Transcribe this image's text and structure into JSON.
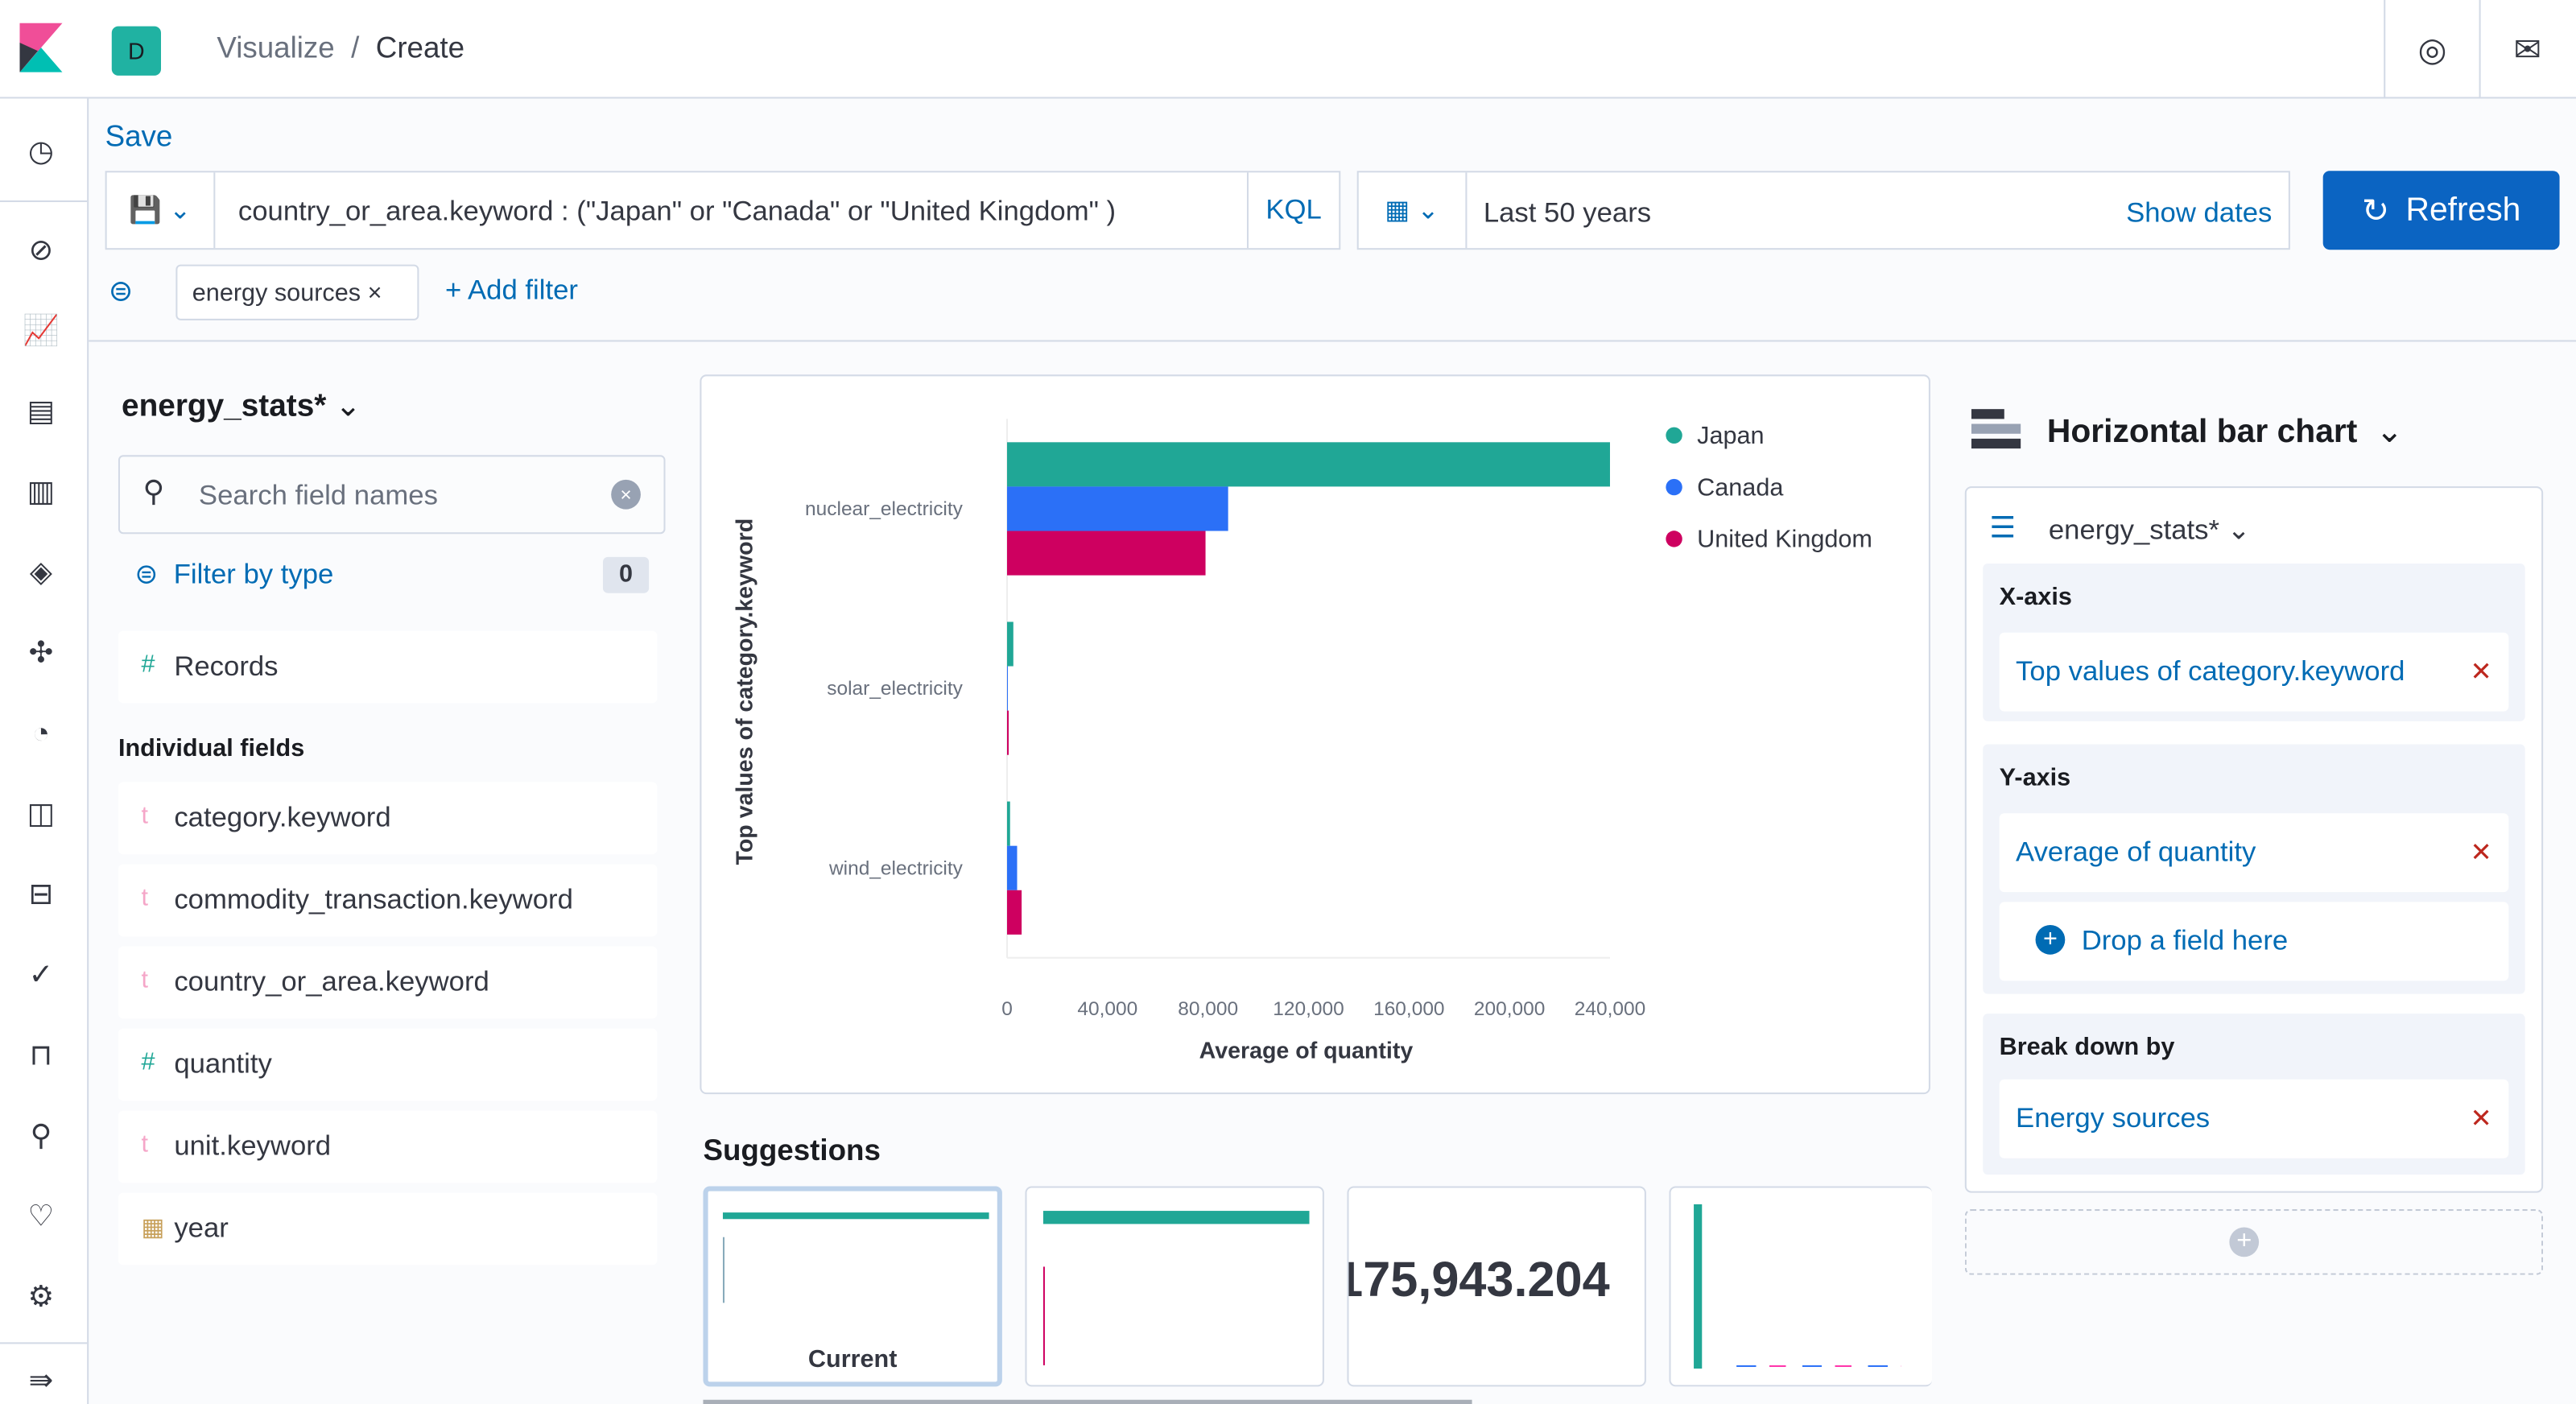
{
  "header": {
    "avatar": "D",
    "breadcrumbs": [
      "Visualize",
      "Create"
    ],
    "icons": [
      "help-icon",
      "mail-icon"
    ]
  },
  "toolbar": {
    "save": "Save",
    "query": "country_or_area.keyword : (\"Japan\" or \"Canada\"  or \"United Kingdom\" )",
    "kql": "KQL",
    "time": "Last 50 years",
    "show_dates": "Show dates",
    "refresh": "Refresh"
  },
  "filters": {
    "pill": "energy sources",
    "add": "+ Add filter"
  },
  "fields": {
    "index": "energy_stats*",
    "search_placeholder": "Search field names",
    "filter_by_type": "Filter by type",
    "filter_count": "0",
    "records": "Records",
    "individual_label": "Individual fields",
    "items": [
      {
        "type": "t",
        "name": "category.keyword"
      },
      {
        "type": "t",
        "name": "commodity_transaction.keyword"
      },
      {
        "type": "t",
        "name": "country_or_area.keyword"
      },
      {
        "type": "#",
        "name": "quantity"
      },
      {
        "type": "t",
        "name": "unit.keyword"
      },
      {
        "type": "date",
        "name": "year"
      }
    ]
  },
  "chart_data": {
    "type": "bar",
    "orientation": "horizontal",
    "categories": [
      "nuclear_electricity",
      "solar_electricity",
      "wind_electricity"
    ],
    "series": [
      {
        "name": "Japan",
        "color": "#20a796",
        "values": [
          240000,
          2500,
          1200
        ]
      },
      {
        "name": "Canada",
        "color": "#2b70f7",
        "values": [
          88000,
          0,
          4000
        ]
      },
      {
        "name": "United Kingdom",
        "color": "#ce0060",
        "values": [
          79000,
          300,
          5800
        ]
      }
    ],
    "xlabel": "Average of quantity",
    "ylabel": "Top values of category.keyword",
    "xlim": [
      0,
      240000
    ],
    "xticks": [
      "0",
      "40,000",
      "80,000",
      "120,000",
      "160,000",
      "200,000",
      "240,000"
    ],
    "legend": "top-right"
  },
  "suggestions": {
    "title": "Suggestions",
    "current": "Current",
    "metric": "175,943.204"
  },
  "config": {
    "chart_type": "Horizontal bar chart",
    "index": "energy_stats*",
    "xaxis_label": "X-axis",
    "xaxis": "Top values of category.keyword",
    "yaxis_label": "Y-axis",
    "yaxis": "Average of quantity",
    "drop": "Drop a field here",
    "breakdown_label": "Break down by",
    "breakdown": "Energy sources"
  }
}
